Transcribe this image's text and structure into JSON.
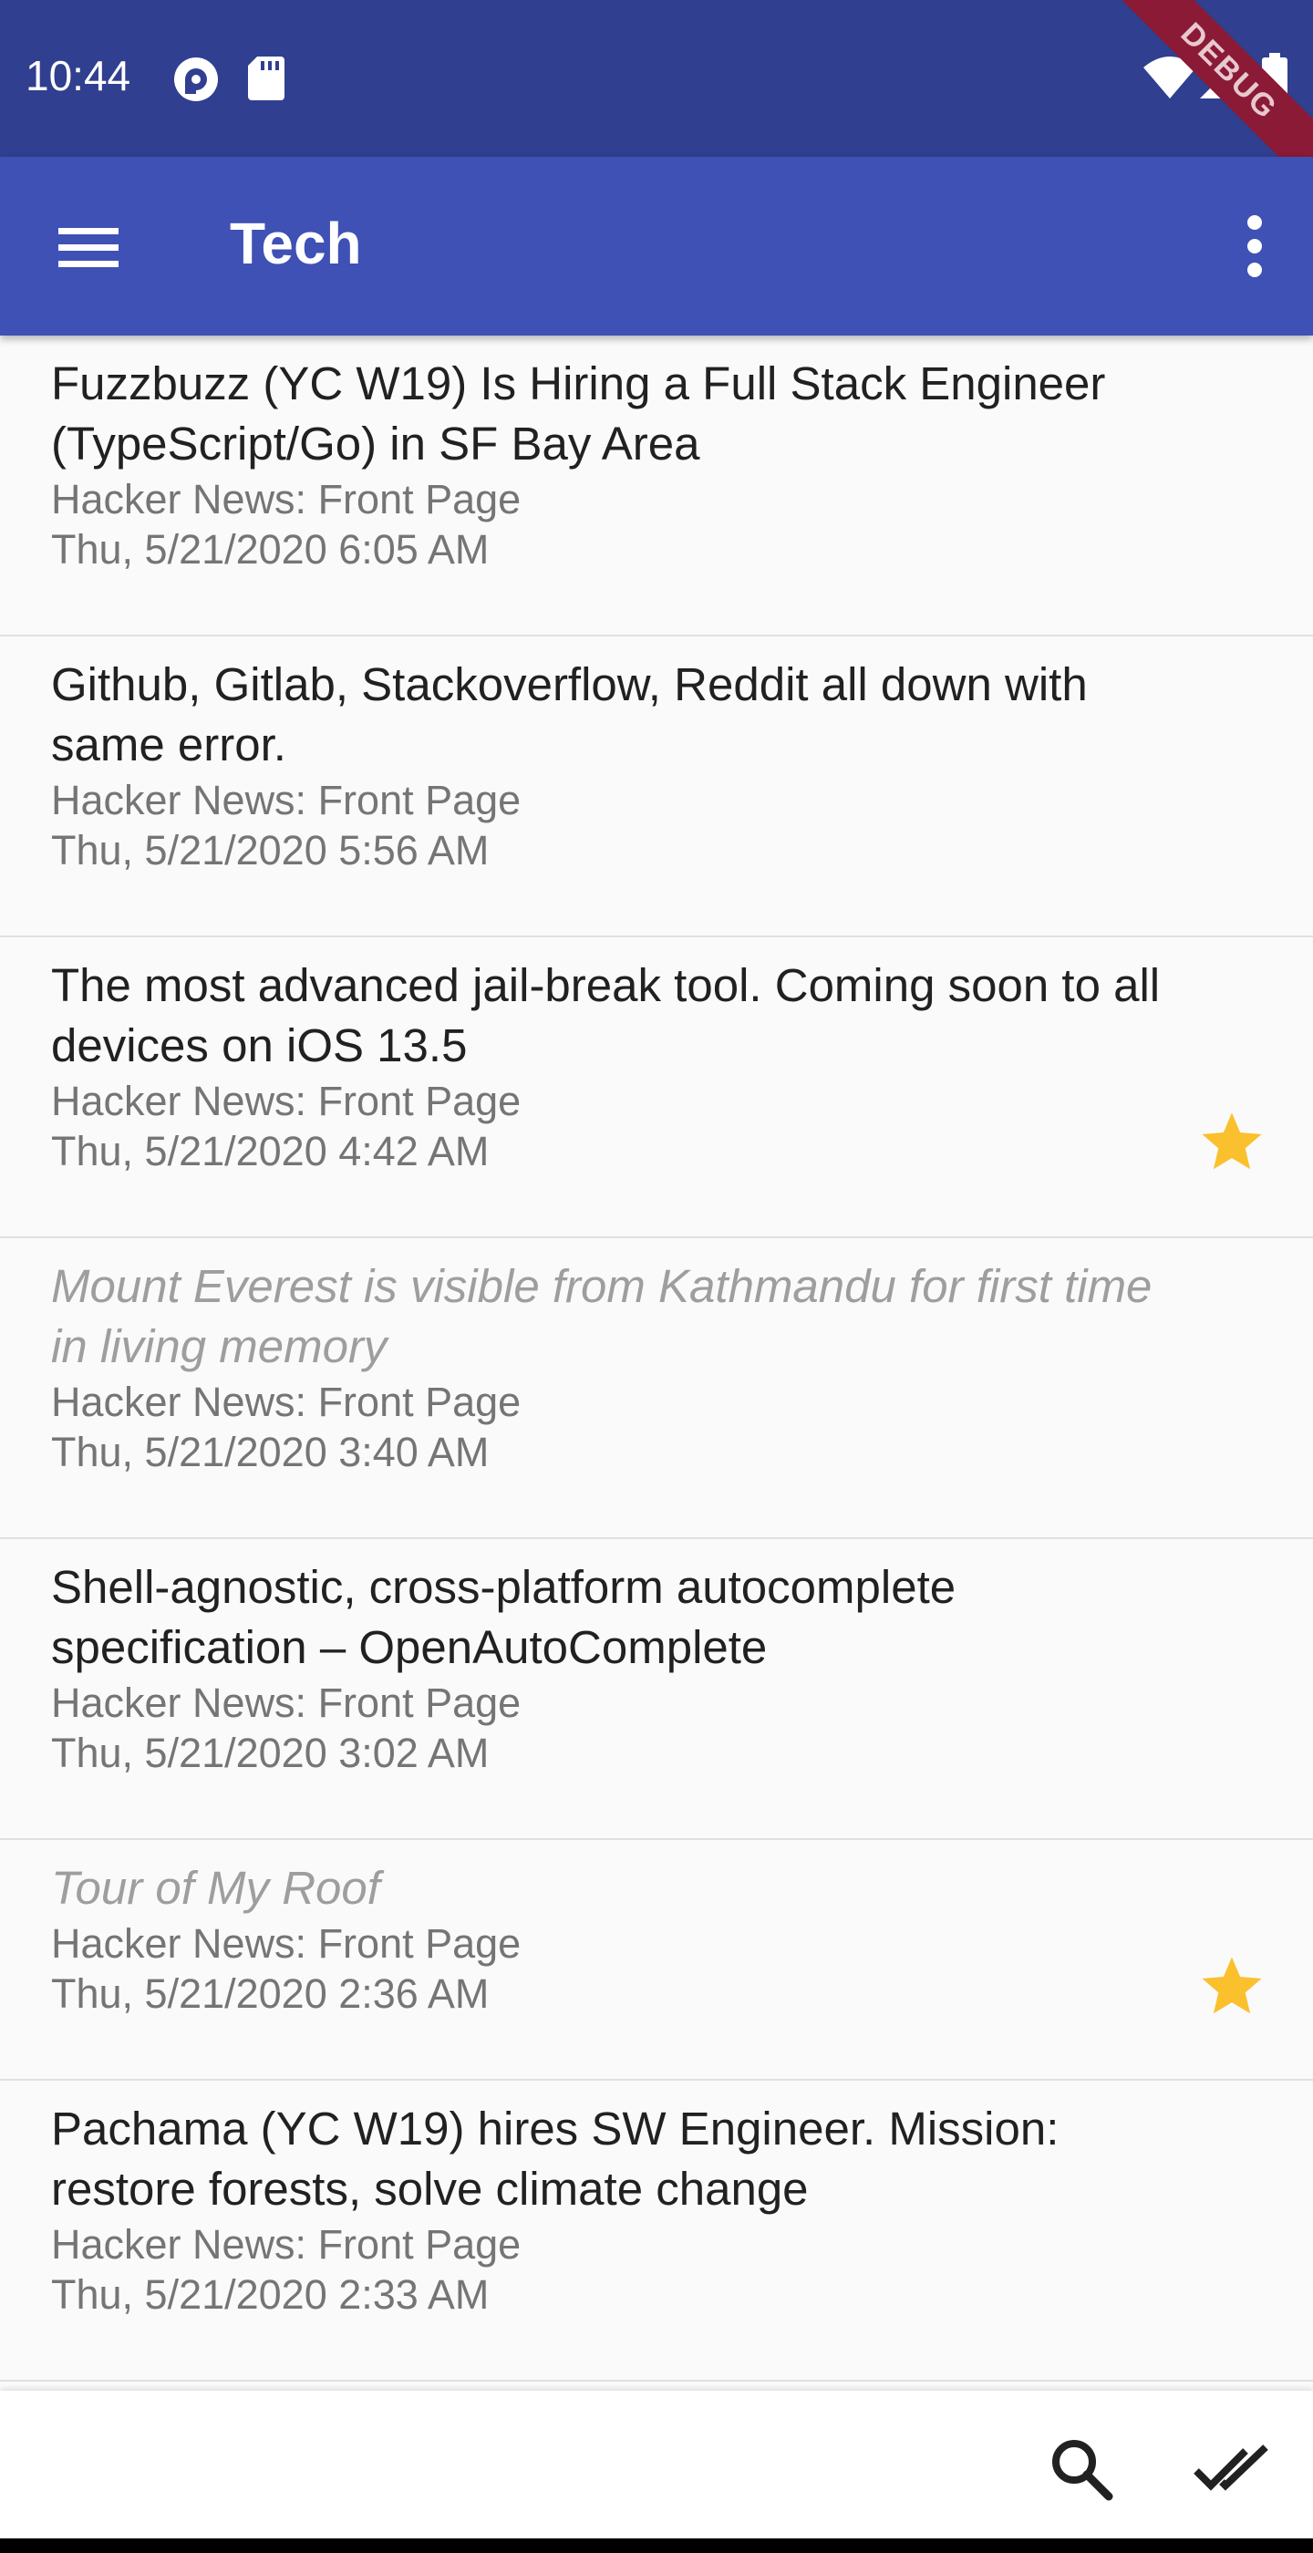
{
  "status_bar": {
    "time": "10:44",
    "left_icons": [
      "pocket-casts-icon",
      "sd-card-icon"
    ],
    "right_icons": [
      "wifi-icon",
      "signal-icon",
      "battery-icon"
    ],
    "debug_banner": "DEBUG",
    "colors": {
      "background": "#303f8f",
      "ribbon": "#8b1a36"
    }
  },
  "app_bar": {
    "title": "Tech",
    "menu_icon": "menu-icon",
    "overflow_icon": "more-vert-icon",
    "color": "#3f51b5"
  },
  "feed": {
    "items": [
      {
        "title": "Fuzzbuzz (YC W19) Is Hiring a Full Stack Engineer (TypeScript/Go) in SF Bay Area",
        "source": "Hacker News: Front Page",
        "date": "Thu, 5/21/2020 6:05 AM",
        "read": false,
        "starred": false
      },
      {
        "title": "Github, Gitlab, Stackoverflow, Reddit all down with same error.",
        "source": "Hacker News: Front Page",
        "date": "Thu, 5/21/2020 5:56 AM",
        "read": false,
        "starred": false
      },
      {
        "title": "The most advanced jail-break tool. Coming soon to all devices on iOS 13.5",
        "source": "Hacker News: Front Page",
        "date": "Thu, 5/21/2020 4:42 AM",
        "read": false,
        "starred": true
      },
      {
        "title": "Mount Everest is visible from Kathmandu for first time in living memory",
        "source": "Hacker News: Front Page",
        "date": "Thu, 5/21/2020 3:40 AM",
        "read": true,
        "starred": false
      },
      {
        "title": "Shell-agnostic, cross-platform autocomplete specification – OpenAutoComplete",
        "source": "Hacker News: Front Page",
        "date": "Thu, 5/21/2020 3:02 AM",
        "read": false,
        "starred": false
      },
      {
        "title": "Tour of My Roof",
        "source": "Hacker News: Front Page",
        "date": "Thu, 5/21/2020 2:36 AM",
        "read": true,
        "starred": true
      },
      {
        "title": "Pachama (YC W19) hires SW Engineer. Mission: restore forests, solve climate change",
        "source": "Hacker News: Front Page",
        "date": "Thu, 5/21/2020 2:33 AM",
        "read": false,
        "starred": false
      }
    ]
  },
  "bottom_bar": {
    "search_icon": "search-icon",
    "mark_all_read_icon": "done-all-icon"
  },
  "colors": {
    "star": "#fbc02d",
    "title_text": "#212121",
    "read_text": "#9e9e9e",
    "meta_text": "#757575",
    "divider": "#e0e0e0"
  }
}
